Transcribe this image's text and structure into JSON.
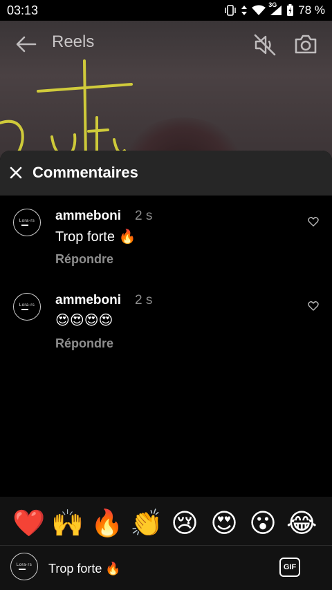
{
  "status_bar": {
    "time": "03:13",
    "network": "3G",
    "battery": "78 %",
    "icons": [
      "vibrate-icon",
      "data-arrows-icon",
      "wifi-icon",
      "signal-icon",
      "battery-icon"
    ]
  },
  "header": {
    "title": "Reels",
    "icons": [
      "back-arrow-icon",
      "mute-icon",
      "camera-icon"
    ]
  },
  "sheet": {
    "title": "Commentaires",
    "close_icon": "close-icon"
  },
  "comments": [
    {
      "username": "ammeboni",
      "time": "2 s",
      "text": "Trop forte 🔥",
      "reply": "Répondre",
      "avatar_logo": "Lora·rs"
    },
    {
      "username": "ammeboni",
      "time": "2 s",
      "text": "😍😍😍😍",
      "reply": "Répondre",
      "avatar_logo": "Lora·rs"
    }
  ],
  "emoji_bar": [
    "❤️",
    "🙌",
    "🔥",
    "👏",
    "😢",
    "😍",
    "😮",
    "😂"
  ],
  "input": {
    "value": "Trop forte 🔥",
    "gif_label": "GIF",
    "avatar_logo": "Lora·rs"
  },
  "colors": {
    "background": "#000000",
    "sheet_header": "#262626",
    "muted_text": "#8e8e8e",
    "neon": "#e8e43a"
  }
}
